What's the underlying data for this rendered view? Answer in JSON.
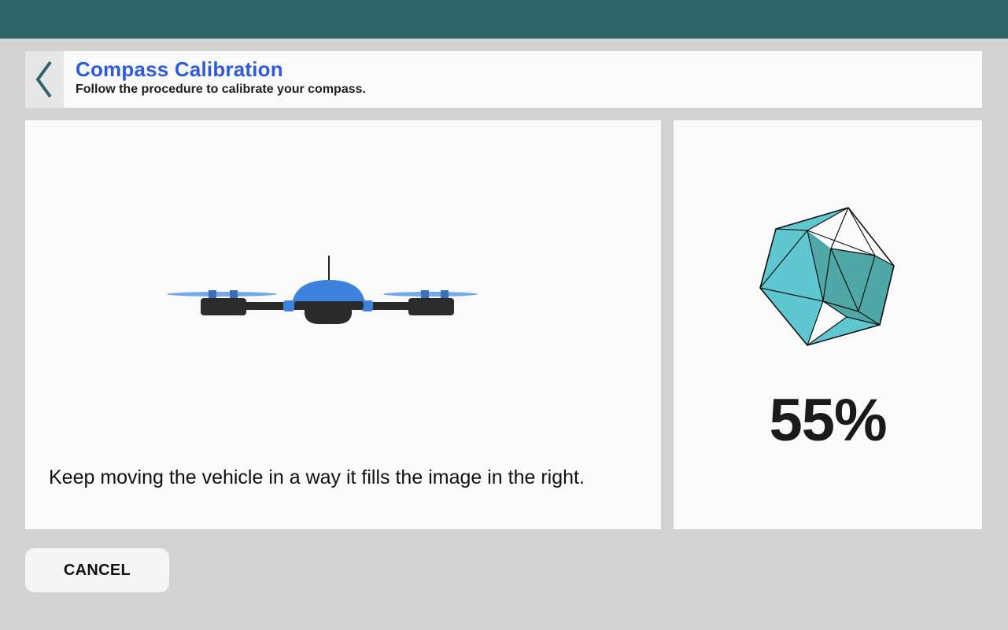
{
  "header": {
    "title": "Compass Calibration",
    "subtitle": "Follow the procedure to calibrate your compass."
  },
  "main": {
    "instruction": "Keep moving the vehicle in a way it fills the image in the right.",
    "progress_text": "55%",
    "progress": 0.55
  },
  "footer": {
    "cancel_label": "CANCEL"
  },
  "colors": {
    "top_bar": "#2d6469",
    "title": "#2e5bdc",
    "drone_body": "#3d82dc",
    "sphere_fill": "#5ec7cf",
    "sphere_fill_dark": "#4fa7a8"
  },
  "icons": {
    "back": "chevron-left-icon"
  }
}
